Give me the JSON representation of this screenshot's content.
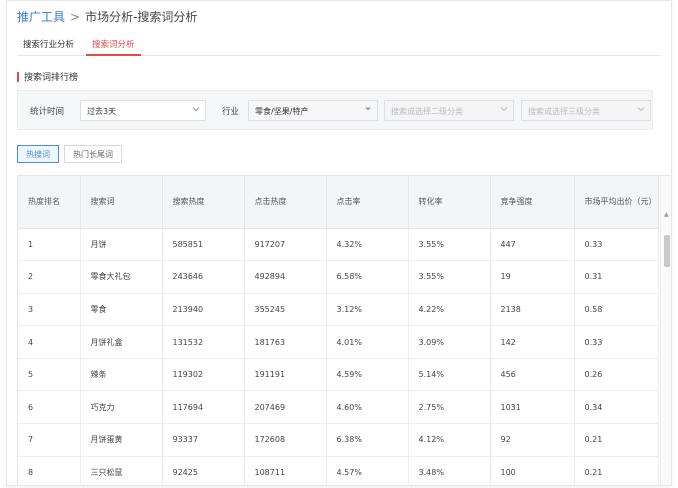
{
  "breadcrumb": {
    "root": "推广工具",
    "separator": ">",
    "current": "市场分析-搜索词分析"
  },
  "tabs": [
    {
      "label": "搜索行业分析",
      "active": false
    },
    {
      "label": "搜索词分析",
      "active": true
    }
  ],
  "section": {
    "title": "搜索词排行榜"
  },
  "filters": {
    "period_label": "统计时间",
    "period_value": "过去3天",
    "industry_label": "行业",
    "industry_value": "零食/坚果/特产",
    "level2_placeholder": "搜索或选择二级分类",
    "level3_placeholder": "搜索或选择三级分类"
  },
  "chips": [
    {
      "label": "热搜词",
      "active": true
    },
    {
      "label": "热门长尾词",
      "active": false
    }
  ],
  "table": {
    "headers": [
      "热度排名",
      "搜索词",
      "搜索热度",
      "点击热度",
      "点击率",
      "转化率",
      "竞争强度",
      "市场平均出价（元）"
    ],
    "rows": [
      [
        "1",
        "月饼",
        "585851",
        "917207",
        "4.32%",
        "3.55%",
        "447",
        "0.33"
      ],
      [
        "2",
        "零食大礼包",
        "243646",
        "492894",
        "6.58%",
        "3.55%",
        "19",
        "0.31"
      ],
      [
        "3",
        "零食",
        "213940",
        "355245",
        "3.12%",
        "4.22%",
        "2138",
        "0.58"
      ],
      [
        "4",
        "月饼礼盒",
        "131532",
        "181763",
        "4.01%",
        "3.09%",
        "142",
        "0.33"
      ],
      [
        "5",
        "辣条",
        "119302",
        "191191",
        "4.59%",
        "5.14%",
        "456",
        "0.26"
      ],
      [
        "6",
        "巧克力",
        "117694",
        "207469",
        "4.60%",
        "2.75%",
        "1031",
        "0.34"
      ],
      [
        "7",
        "月饼蛋黄",
        "93337",
        "172608",
        "6.38%",
        "4.12%",
        "92",
        "0.21"
      ],
      [
        "8",
        "三只松鼠",
        "92425",
        "108711",
        "4.57%",
        "3.48%",
        "100",
        "0.21"
      ]
    ]
  },
  "colors": {
    "accent": "#e34b4b",
    "link": "#3a7bd5",
    "chip_active": "#4a90e2"
  }
}
